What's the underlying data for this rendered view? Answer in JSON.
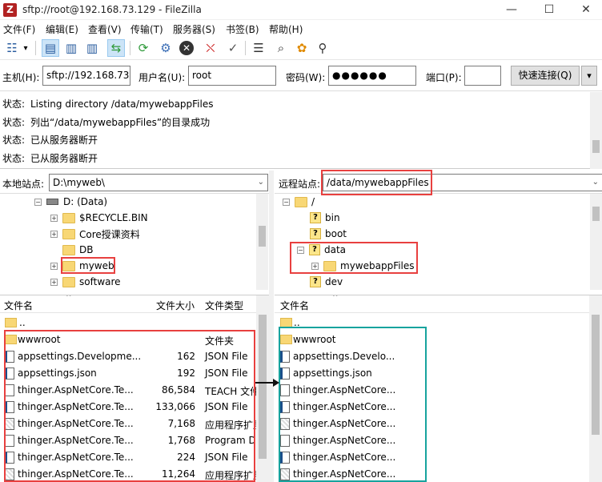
{
  "window": {
    "title": "sftp://root@192.168.73.129 - FileZilla",
    "app_icon": "Z",
    "minimize": "—",
    "maximize": "☐",
    "close": "✕"
  },
  "menu": [
    "文件(F)",
    "编辑(E)",
    "查看(V)",
    "传输(T)",
    "服务器(S)",
    "书签(B)",
    "帮助(H)"
  ],
  "quickconnect": {
    "host_label": "主机(H):",
    "host_value": "sftp://192.168.73.",
    "user_label": "用户名(U):",
    "user_value": "root",
    "pass_label": "密码(W):",
    "pass_value": "●●●●●●",
    "port_label": "端口(P):",
    "port_value": "",
    "button_label": "快速连接(Q)",
    "dropdown_arrow": "▾"
  },
  "log": [
    {
      "key": "状态:",
      "text": "Listing directory /data/mywebappFiles"
    },
    {
      "key": "状态:",
      "text": "列出“/data/mywebappFiles”的目录成功"
    },
    {
      "key": "状态:",
      "text": "已从服务器断开"
    },
    {
      "key": "状态:",
      "text": "已从服务器断开"
    }
  ],
  "local": {
    "site_label": "本地站点:",
    "site_path": "D:\\myweb\\",
    "tree": [
      {
        "label": "D: (Data)",
        "type": "drive",
        "expander": "−"
      },
      {
        "label": "$RECYCLE.BIN",
        "type": "folder",
        "expander": "+"
      },
      {
        "label": "Core授课资料",
        "type": "folder",
        "expander": "+"
      },
      {
        "label": "DB",
        "type": "folder",
        "expander": ""
      },
      {
        "label": "myweb",
        "type": "folder",
        "expander": "+"
      },
      {
        "label": "software",
        "type": "folder",
        "expander": "+"
      }
    ],
    "headers": {
      "name": "文件名",
      "size": "文件大小",
      "type": "文件类型"
    },
    "files": [
      {
        "name": "..",
        "size": "",
        "type": "",
        "icon": "folder"
      },
      {
        "name": "wwwroot",
        "size": "",
        "type": "文件夹",
        "icon": "folder"
      },
      {
        "name": "appsettings.Developme...",
        "size": "162",
        "type": "JSON File",
        "icon": "json"
      },
      {
        "name": "appsettings.json",
        "size": "192",
        "type": "JSON File",
        "icon": "json"
      },
      {
        "name": "thinger.AspNetCore.Te...",
        "size": "86,584",
        "type": "TEACH 文件",
        "icon": "file"
      },
      {
        "name": "thinger.AspNetCore.Te...",
        "size": "133,066",
        "type": "JSON File",
        "icon": "json"
      },
      {
        "name": "thinger.AspNetCore.Te...",
        "size": "7,168",
        "type": "应用程序扩展",
        "icon": "exe"
      },
      {
        "name": "thinger.AspNetCore.Te...",
        "size": "1,768",
        "type": "Program D",
        "icon": "file"
      },
      {
        "name": "thinger.AspNetCore.Te...",
        "size": "224",
        "type": "JSON File",
        "icon": "json"
      },
      {
        "name": "thinger.AspNetCore.Te...",
        "size": "11,264",
        "type": "应用程序扩展",
        "icon": "exe"
      }
    ]
  },
  "remote": {
    "site_label": "远程站点:",
    "site_path": "/data/mywebappFiles",
    "tree": [
      {
        "label": "/",
        "type": "folder",
        "expander": "−"
      },
      {
        "label": "bin",
        "type": "qfolder",
        "expander": ""
      },
      {
        "label": "boot",
        "type": "qfolder",
        "expander": ""
      },
      {
        "label": "data",
        "type": "qfolder",
        "expander": "−"
      },
      {
        "label": "mywebappFiles",
        "type": "folder",
        "expander": "+"
      },
      {
        "label": "dev",
        "type": "qfolder",
        "expander": ""
      }
    ],
    "headers": {
      "name": "文件名"
    },
    "files": [
      {
        "name": "..",
        "icon": "folder"
      },
      {
        "name": "wwwroot",
        "icon": "folder"
      },
      {
        "name": "appsettings.Develo...",
        "icon": "json"
      },
      {
        "name": "appsettings.json",
        "icon": "json"
      },
      {
        "name": "thinger.AspNetCore...",
        "icon": "file"
      },
      {
        "name": "thinger.AspNetCore...",
        "icon": "json"
      },
      {
        "name": "thinger.AspNetCore...",
        "icon": "exe"
      },
      {
        "name": "thinger.AspNetCore...",
        "icon": "file"
      },
      {
        "name": "thinger.AspNetCore...",
        "icon": "json"
      },
      {
        "name": "thinger.AspNetCore...",
        "icon": "exe"
      }
    ]
  },
  "colors": {
    "highlight_red": "#e8403f",
    "highlight_teal": "#17a39e",
    "folder": "#f8d775"
  }
}
